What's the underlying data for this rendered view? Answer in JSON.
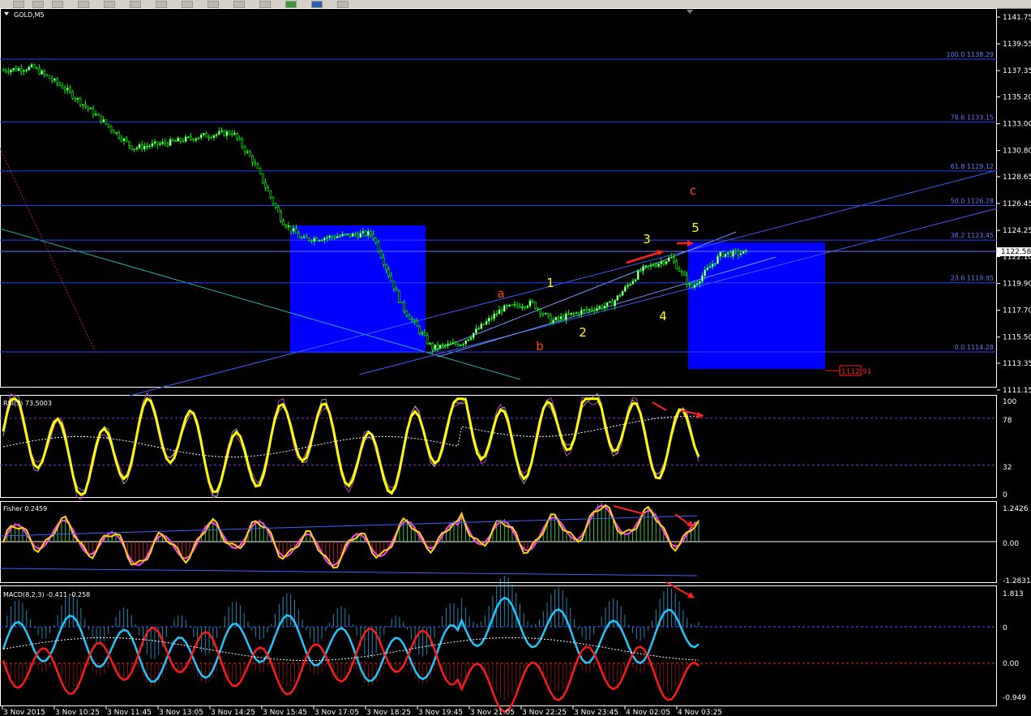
{
  "window": {
    "symbol_label": "GOLD,M5"
  },
  "price_axis": {
    "ticks": [
      "1141.75",
      "1139.55",
      "1137.35",
      "1135.20",
      "1133.00",
      "1130.80",
      "1128.65",
      "1126.45",
      "1124.25",
      "1122.10",
      "1119.90",
      "1117.70",
      "1115.50",
      "1113.35",
      "1111.15"
    ],
    "current_price": "1122.58",
    "target_label": "1112.91"
  },
  "fib_levels": [
    {
      "label": "100.0 1138.29",
      "price": 1138.29
    },
    {
      "label": "78.6 1133.15",
      "price": 1133.15
    },
    {
      "label": "61.8 1129.12",
      "price": 1129.12
    },
    {
      "label": "50.0 1126.28",
      "price": 1126.28
    },
    {
      "label": "38.2 1123.45",
      "price": 1123.45
    },
    {
      "label": "23.6 1119.95",
      "price": 1119.95
    },
    {
      "label": "0.0 1114.28",
      "price": 1114.28
    }
  ],
  "wave_labels": [
    {
      "text": "a",
      "color": "#ff4500"
    },
    {
      "text": "b",
      "color": "#ff4500"
    },
    {
      "text": "c",
      "color": "#ff4500"
    },
    {
      "text": "1",
      "color": "#ffff00"
    },
    {
      "text": "2",
      "color": "#ffff00"
    },
    {
      "text": "3",
      "color": "#ffff00"
    },
    {
      "text": "4",
      "color": "#ffff00"
    },
    {
      "text": "5",
      "color": "#ffff00"
    }
  ],
  "time_axis": [
    "3 Nov 2015",
    "3 Nov 10:25",
    "3 Nov 11:45",
    "3 Nov 13:05",
    "3 Nov 14:25",
    "3 Nov 15:45",
    "3 Nov 17:05",
    "3 Nov 18:25",
    "3 Nov 19:45",
    "3 Nov 21:05",
    "3 Nov 22:25",
    "3 Nov 23:45",
    "4 Nov 02:05",
    "4 Nov 03:25"
  ],
  "rsi_panel": {
    "label": "RSI(5) 73.5003",
    "ticks": [
      "100",
      "78",
      "32",
      "0"
    ],
    "levels": [
      78,
      32
    ]
  },
  "fisher_panel": {
    "label": "Fisher 0.2459",
    "ticks": [
      "1.2426",
      "0.00",
      "-1.2831"
    ]
  },
  "macd_panel": {
    "label": "MACD(8,2,3) -0.411 -0.258",
    "ticks": [
      "1.813",
      "0",
      "0.00",
      "-0.949"
    ]
  },
  "colors": {
    "candle": "#00ff00",
    "fib": "#2244ff",
    "box": "#0000ff",
    "rsi": "#ffff00",
    "macd_blue": "#1ec8ff",
    "macd_red": "#ff1a1a",
    "arrow": "#ff2020"
  },
  "chart_data": {
    "type": "line",
    "title": "GOLD,M5",
    "price_close_waypoints": [
      {
        "t": 0,
        "y": 1137.4
      },
      {
        "t": 0.03,
        "y": 1137.6
      },
      {
        "t": 0.06,
        "y": 1136.0
      },
      {
        "t": 0.1,
        "y": 1133.2
      },
      {
        "t": 0.13,
        "y": 1131.0
      },
      {
        "t": 0.17,
        "y": 1131.5
      },
      {
        "t": 0.2,
        "y": 1132.0
      },
      {
        "t": 0.23,
        "y": 1132.3
      },
      {
        "t": 0.25,
        "y": 1130.0
      },
      {
        "t": 0.28,
        "y": 1125.0
      },
      {
        "t": 0.3,
        "y": 1123.5
      },
      {
        "t": 0.34,
        "y": 1123.8
      },
      {
        "t": 0.37,
        "y": 1124.0
      },
      {
        "t": 0.4,
        "y": 1118.0
      },
      {
        "t": 0.43,
        "y": 1114.6
      },
      {
        "t": 0.46,
        "y": 1115.0
      },
      {
        "t": 0.5,
        "y": 1117.8
      },
      {
        "t": 0.53,
        "y": 1118.3
      },
      {
        "t": 0.55,
        "y": 1116.8
      },
      {
        "t": 0.58,
        "y": 1117.6
      },
      {
        "t": 0.61,
        "y": 1118.2
      },
      {
        "t": 0.64,
        "y": 1121.0
      },
      {
        "t": 0.67,
        "y": 1122.0
      },
      {
        "t": 0.69,
        "y": 1119.5
      },
      {
        "t": 0.72,
        "y": 1122.3
      },
      {
        "t": 0.745,
        "y": 1122.4
      }
    ]
  }
}
